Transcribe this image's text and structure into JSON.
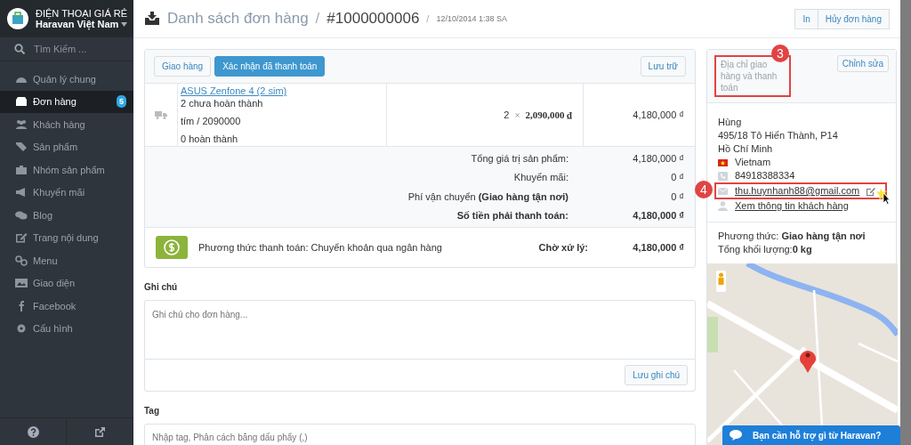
{
  "sidebar": {
    "store_name": "ĐIỆN THOẠI GIÁ RẺ",
    "account": "Haravan Việt Nam",
    "search": {
      "placeholder": "Tìm Kiếm ..."
    },
    "items": [
      {
        "label": "Quản lý chung",
        "kind": "gauge",
        "selected": false
      },
      {
        "label": "Đơn hàng",
        "kind": "inbox",
        "selected": true,
        "badge": "5"
      },
      {
        "label": "Khách hàng",
        "kind": "users",
        "selected": false
      },
      {
        "label": "Sản phẩm",
        "kind": "tag",
        "selected": false
      },
      {
        "label": "Nhóm sản phẩm",
        "kind": "briefcase",
        "selected": false
      },
      {
        "label": "Khuyến mãi",
        "kind": "megaphone",
        "selected": false
      },
      {
        "label": "Blog",
        "kind": "comments",
        "selected": false
      },
      {
        "label": "Trang nội dung",
        "kind": "edit",
        "selected": false
      },
      {
        "label": "Menu",
        "kind": "link",
        "selected": false
      },
      {
        "label": "Giao diện",
        "kind": "image",
        "selected": false
      },
      {
        "label": "Facebook",
        "kind": "facebook",
        "selected": false
      },
      {
        "label": "Cấu hình",
        "kind": "gear",
        "selected": false
      }
    ]
  },
  "header": {
    "breadcrumb": "Danh sách đơn hàng",
    "separators": [
      "/",
      "/"
    ],
    "order_number": "#1000000006",
    "date": "12/10/2014 1:38 SA",
    "buttons": [
      "In",
      "Hủy đơn hàng"
    ]
  },
  "order": {
    "actions": [
      {
        "label": "Giao hàng",
        "primary": false
      },
      {
        "label": "Xác nhận đã thanh toán",
        "primary": true
      }
    ],
    "archive_button": "Lưu trữ",
    "line_items": [
      {
        "name": "ASUS Zenfone 4 (2 sim)",
        "unfulfilled": "2 chưa hoàn thành",
        "variant": "tím / 2090000",
        "fulfilled": "0 hoàn thành",
        "quantity": "2",
        "times": "×",
        "price": "2,090,000 ₫",
        "total": "4,180,000 ₫"
      }
    ],
    "summary": [
      {
        "label": "Tổng giá trị sản phẩm:",
        "value": "4,180,000 ₫",
        "bold": false
      },
      {
        "label": "Khuyến mãi:",
        "value": "0 ₫",
        "bold": false
      },
      {
        "label": "Phí vận chuyển **(Giao hàng tận nơi)**",
        "value": "0 ₫",
        "bold": false
      },
      {
        "label": "Số tiền phải thanh toán:",
        "value": "4,180,000 ₫",
        "bold": true
      }
    ],
    "payment": {
      "method": "Phương thức thanh toán: Chuyển khoản qua ngân hàng",
      "status": "Chờ xử lý:",
      "amount": "4,180,000 ₫"
    }
  },
  "notes": {
    "title": "Ghi chú",
    "placeholder": "Ghi chú cho đơn hàng...",
    "button": "Lưu ghi chú"
  },
  "tags": {
    "title": "Tag",
    "placeholder": "Nhập tag, Phân cách bằng dấu phẩy (,)"
  },
  "address": {
    "title": "Địa chỉ giao hàng và thanh toán",
    "edit_button": "Chỉnh sửa",
    "name": "Hùng",
    "street": "495/18 Tô Hiến Thành, P14",
    "city": "Hồ Chí Minh",
    "country": "Vietnam",
    "phone": "84918388334",
    "email": "thu.huynhanh88@gmail.com",
    "customer_link": "Xem thông tin khách hàng",
    "shipping_method": "Phương thức: **Giao hàng tận nơi**",
    "weight": "Tổng khối lượng:**0 kg**"
  },
  "annotations": [
    "3",
    "4"
  ],
  "chat_button": "Bạn cần hỗ trợ gì từ Haravan?"
}
